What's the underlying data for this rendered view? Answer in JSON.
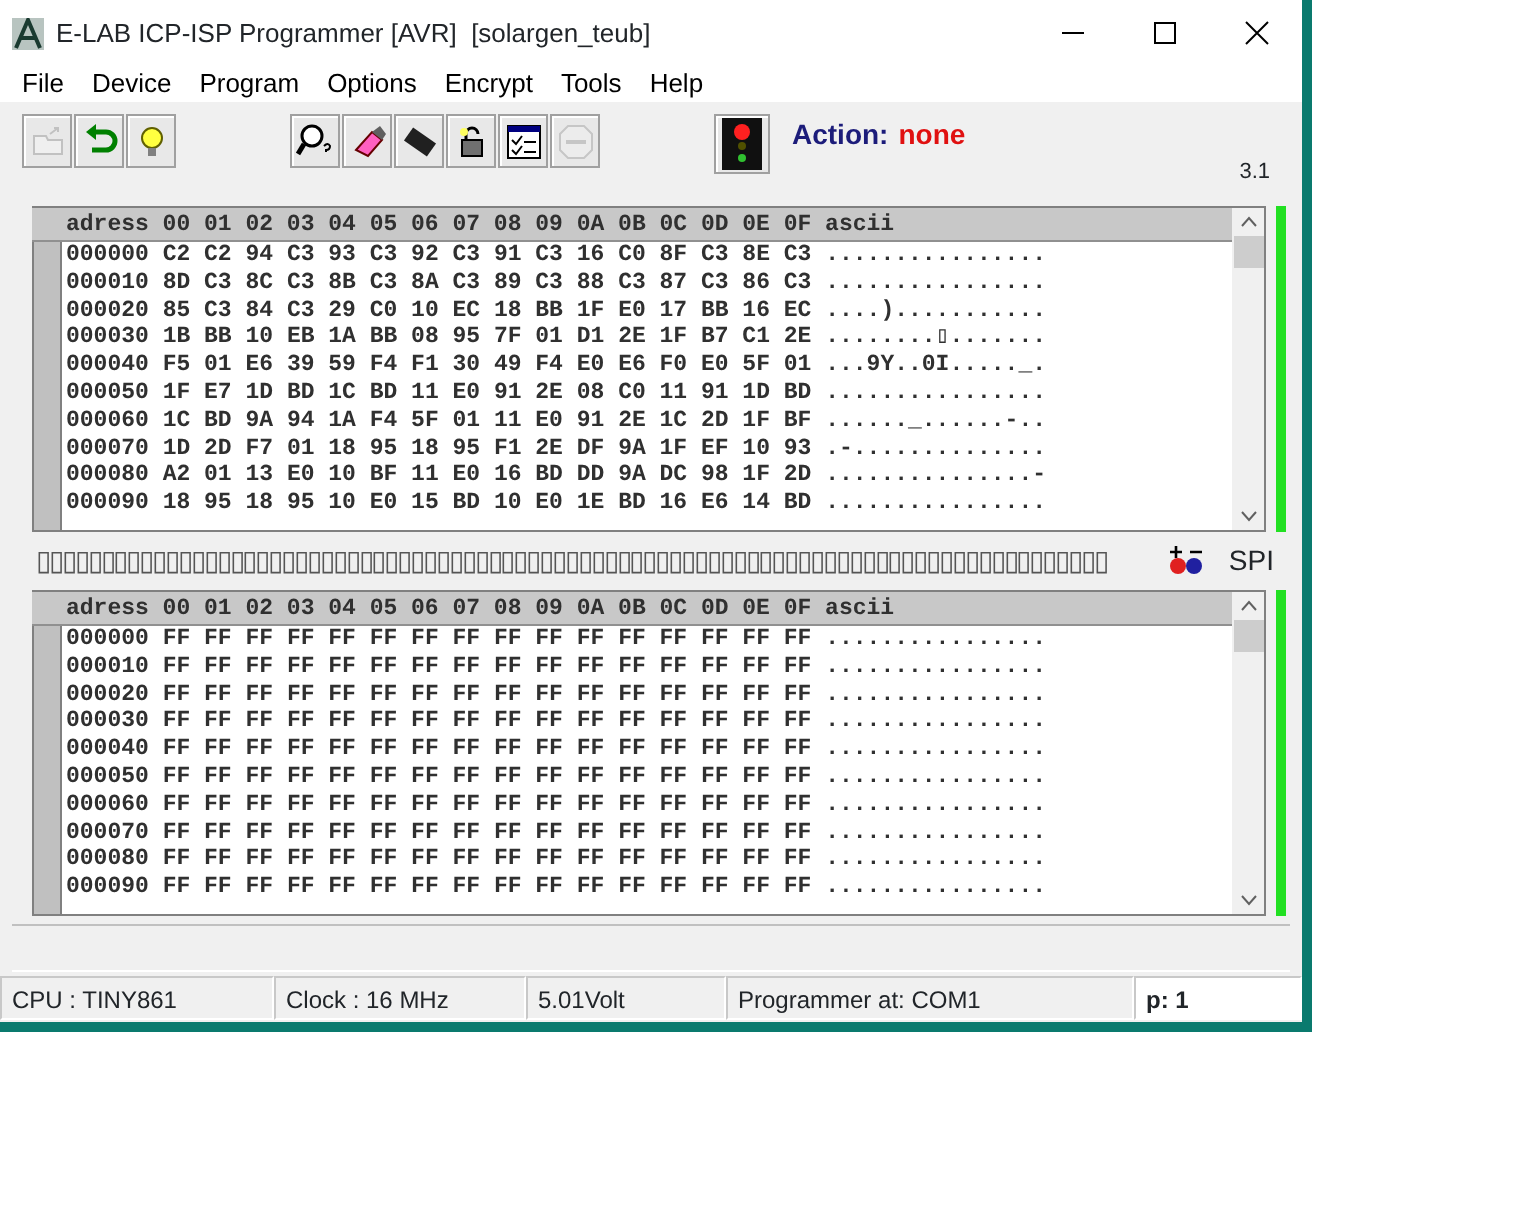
{
  "window": {
    "title": "E-LAB ICP-ISP Programmer [AVR]  [solargen_teub]"
  },
  "menu": [
    "File",
    "Device",
    "Program",
    "Options",
    "Encrypt",
    "Tools",
    "Help"
  ],
  "toolbar": [
    {
      "kind": "open",
      "disabled": true
    },
    {
      "kind": "undo",
      "disabled": false
    },
    {
      "kind": "bulb",
      "disabled": false
    },
    {
      "kind": "gap"
    },
    {
      "kind": "inspect",
      "disabled": false
    },
    {
      "kind": "erase",
      "disabled": false
    },
    {
      "kind": "chip",
      "disabled": false
    },
    {
      "kind": "lock",
      "disabled": false
    },
    {
      "kind": "checklist",
      "disabled": false
    },
    {
      "kind": "stop",
      "disabled": true
    },
    {
      "kind": "gap"
    },
    {
      "kind": "traffic-light",
      "disabled": false
    }
  ],
  "action": {
    "label": "Action:",
    "value": "none"
  },
  "version": "3.1",
  "panels": [
    {
      "header": "adress 00 01 02 03 04 05 06 07 08 09 0A 0B 0C 0D 0E 0F ascii",
      "level": 1,
      "rows": [
        {
          "address": "000000",
          "bytes": "C2 C2 94 C3 93 C3 92 C3 91 C3 16 C0 8F C3 8E C3",
          "ascii": "................"
        },
        {
          "address": "000010",
          "bytes": "8D C3 8C C3 8B C3 8A C3 89 C3 88 C3 87 C3 86 C3",
          "ascii": "................"
        },
        {
          "address": "000020",
          "bytes": "85 C3 84 C3 29 C0 10 EC 18 BB 1F E0 17 BB 16 EC",
          "ascii": "....)..........."
        },
        {
          "address": "000030",
          "bytes": "1B BB 10 EB 1A BB 08 95 7F 01 D1 2E 1F B7 C1 2E",
          "ascii": "........▯......."
        },
        {
          "address": "000040",
          "bytes": "F5 01 E6 39 59 F4 F1 30 49 F4 E0 E6 F0 E0 5F 01",
          "ascii": "...9Y..0I....._."
        },
        {
          "address": "000050",
          "bytes": "1F E7 1D BD 1C BD 11 E0 91 2E 08 C0 11 91 1D BD",
          "ascii": "................"
        },
        {
          "address": "000060",
          "bytes": "1C BD 9A 94 1A F4 5F 01 11 E0 91 2E 1C 2D 1F BF",
          "ascii": "......_......-.."
        },
        {
          "address": "000070",
          "bytes": "1D 2D F7 01 18 95 18 95 F1 2E DF 9A 1F EF 10 93",
          "ascii": ".-.............."
        },
        {
          "address": "000080",
          "bytes": "A2 01 13 E0 10 BF 11 E0 16 BD DD 9A DC 98 1F 2D",
          "ascii": "...............-"
        },
        {
          "address": "000090",
          "bytes": "18 95 18 95 10 E0 15 BD 10 E0 1E BD 16 E6 14 BD",
          "ascii": "................"
        }
      ]
    },
    {
      "header": "adress 00 01 02 03 04 05 06 07 08 09 0A 0B 0C 0D 0E 0F ascii",
      "level": 1,
      "rows": [
        {
          "address": "000000",
          "bytes": "FF FF FF FF FF FF FF FF FF FF FF FF FF FF FF FF",
          "ascii": "................"
        },
        {
          "address": "000010",
          "bytes": "FF FF FF FF FF FF FF FF FF FF FF FF FF FF FF FF",
          "ascii": "................"
        },
        {
          "address": "000020",
          "bytes": "FF FF FF FF FF FF FF FF FF FF FF FF FF FF FF FF",
          "ascii": "................"
        },
        {
          "address": "000030",
          "bytes": "FF FF FF FF FF FF FF FF FF FF FF FF FF FF FF FF",
          "ascii": "................"
        },
        {
          "address": "000040",
          "bytes": "FF FF FF FF FF FF FF FF FF FF FF FF FF FF FF FF",
          "ascii": "................"
        },
        {
          "address": "000050",
          "bytes": "FF FF FF FF FF FF FF FF FF FF FF FF FF FF FF FF",
          "ascii": "................"
        },
        {
          "address": "000060",
          "bytes": "FF FF FF FF FF FF FF FF FF FF FF FF FF FF FF FF",
          "ascii": "................"
        },
        {
          "address": "000070",
          "bytes": "FF FF FF FF FF FF FF FF FF FF FF FF FF FF FF FF",
          "ascii": "................"
        },
        {
          "address": "000080",
          "bytes": "FF FF FF FF FF FF FF FF FF FF FF FF FF FF FF FF",
          "ascii": "................"
        },
        {
          "address": "000090",
          "bytes": "FF FF FF FF FF FF FF FF FF FF FF FF FF FF FF FF",
          "ascii": "................"
        }
      ]
    }
  ],
  "separator": {
    "glyphs": "▯▯▯▯▯▯▯▯▯▯▯▯▯▯▯▯▯▯▯▯▯▯▯▯▯▯▯▯▯▯▯▯▯▯▯▯▯▯▯▯▯▯▯▯▯▯▯▯▯▯▯▯▯▯▯▯▯▯▯▯▯▯▯▯▯▯▯▯▯▯▯▯▯▯▯▯▯▯▯▯▯▯▯",
    "mode": "SPI"
  },
  "status_bar": [
    "CPU : TINY861",
    "Clock : 16 MHz",
    "5.01Volt",
    "Programmer at: COM1",
    "p: 1"
  ]
}
